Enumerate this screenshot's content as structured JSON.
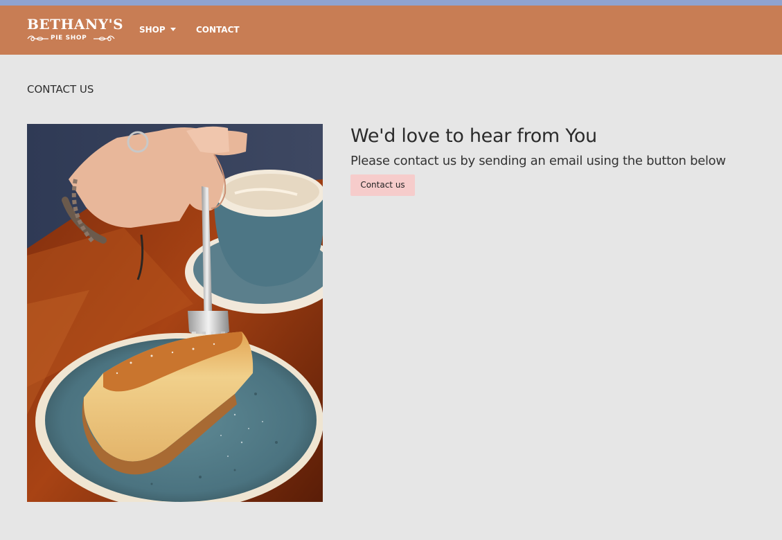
{
  "brand": {
    "name": "BETHANY'S",
    "tagline": "PIE SHOP",
    "text_color": "#ffffff",
    "nav_background": "#c87d54"
  },
  "nav": {
    "items": [
      {
        "label": "SHOP",
        "has_dropdown": true,
        "icon": "caret-down-icon"
      },
      {
        "label": "CONTACT",
        "has_dropdown": false
      }
    ]
  },
  "page": {
    "heading": "CONTACT US",
    "background": "#e6e6e6"
  },
  "main": {
    "image_description_icon": "cheesecake-photo",
    "title": "We'd love to hear from You",
    "subtitle": "Please contact us by sending an email using the button below",
    "button_label": "Contact us",
    "button_color": "#f6cccb"
  }
}
